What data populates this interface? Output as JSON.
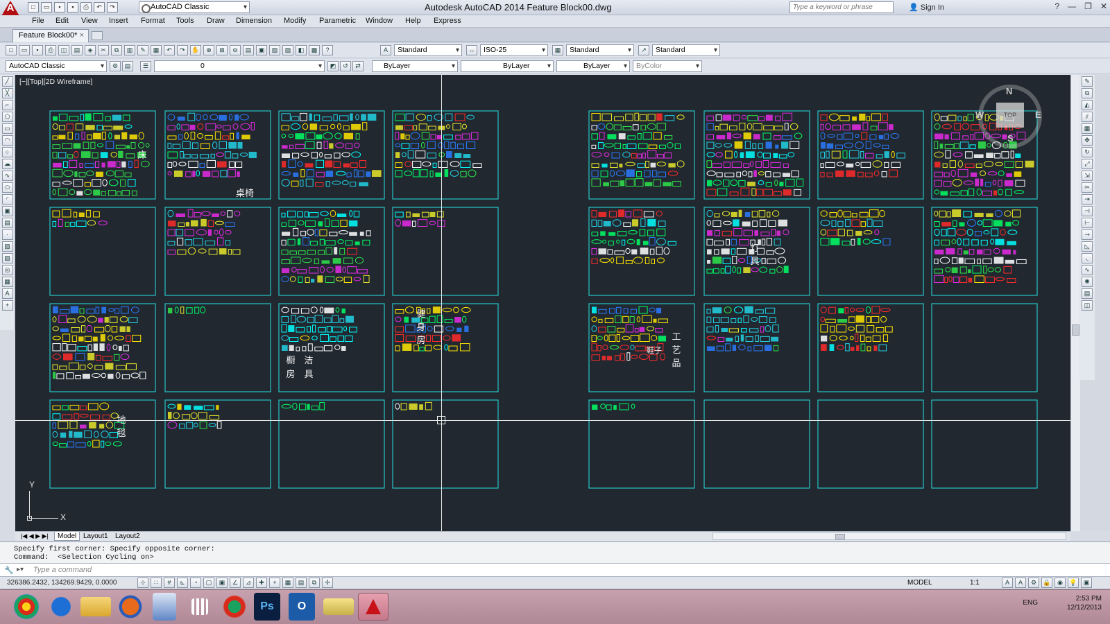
{
  "titlebar": {
    "workspace": "AutoCAD Classic",
    "title": "Autodesk AutoCAD 2014    Feature Block00.dwg",
    "search_placeholder": "Type a keyword or phrase",
    "signin": "Sign In"
  },
  "menu": [
    "File",
    "Edit",
    "View",
    "Insert",
    "Format",
    "Tools",
    "Draw",
    "Dimension",
    "Modify",
    "Parametric",
    "Window",
    "Help",
    "Express"
  ],
  "doc_tab": "Feature Block00*",
  "styles_toolbar": {
    "text_style": "Standard",
    "dim_style": "ISO-25",
    "table_style": "Standard",
    "mleader_style": "Standard"
  },
  "layers_toolbar": {
    "workspace": "AutoCAD Classic",
    "layer": "0",
    "color": "ByLayer",
    "linetype": "ByLayer",
    "lineweight": "ByLayer",
    "plotstyle": "ByColor"
  },
  "viewport_label": "[−][Top][2D Wireframe]",
  "viewcube": {
    "n": "N",
    "s": "S",
    "e": "E",
    "w": "W",
    "face": "TOP"
  },
  "ucs": {
    "x": "X",
    "y": "Y"
  },
  "sheet_labels": {
    "bed": "床",
    "table_chair": "桌椅",
    "gym": [
      "健",
      "身",
      "房"
    ],
    "kitchen_col1": [
      "橱",
      "房"
    ],
    "kitchen_col2": [
      "洁",
      "具"
    ],
    "lamps": [
      "灯",
      "具"
    ],
    "shoes": "鞋子",
    "crafts": [
      "工",
      "艺",
      "品"
    ],
    "carpet": [
      "地",
      "毯"
    ]
  },
  "layout_tabs": [
    "Model",
    "Layout1",
    "Layout2"
  ],
  "command_history": [
    "Specify first corner: Specify opposite corner:",
    "Command:  <Selection Cycling on>"
  ],
  "command_placeholder": "Type a command",
  "status": {
    "coords": "326386.2432, 134269.9429, 0.0000",
    "model": "MODEL",
    "scale": "1:1"
  },
  "tray": {
    "lang": "ENG",
    "time": "2:53 PM",
    "date": "12/12/2013"
  },
  "colors": {
    "canvas": "#212830",
    "frame": "#27c5c5",
    "red": "#e8232a"
  }
}
